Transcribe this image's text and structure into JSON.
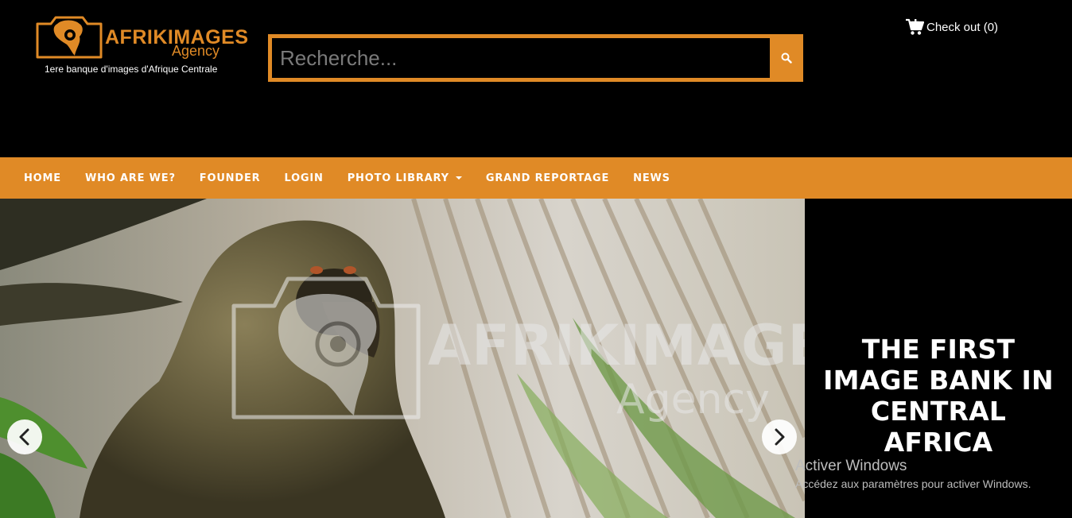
{
  "logo": {
    "brand": "AFRIKIMAGES",
    "agency": "Agency",
    "tagline": "1ere banque d'images d'Afrique Centrale"
  },
  "search": {
    "placeholder": "Recherche..."
  },
  "cart": {
    "label": "Check out (0)"
  },
  "nav": {
    "items": [
      {
        "label": "HOME"
      },
      {
        "label": "WHO ARE WE?"
      },
      {
        "label": "FOUNDER"
      },
      {
        "label": "LOGIN"
      },
      {
        "label": "PHOTO LIBRARY"
      },
      {
        "label": "GRAND REPORTAGE"
      },
      {
        "label": "NEWS"
      }
    ]
  },
  "hero": {
    "watermark_brand": "AFRIKIMAGES",
    "watermark_agency": "Agency",
    "title": "THE FIRST IMAGE BANK IN CENTRAL AFRICA"
  },
  "windows": {
    "title": "Activer Windows",
    "subtitle": "Accédez aux paramètres pour activer Windows."
  },
  "colors": {
    "accent": "#e08a26",
    "background": "#000000"
  }
}
